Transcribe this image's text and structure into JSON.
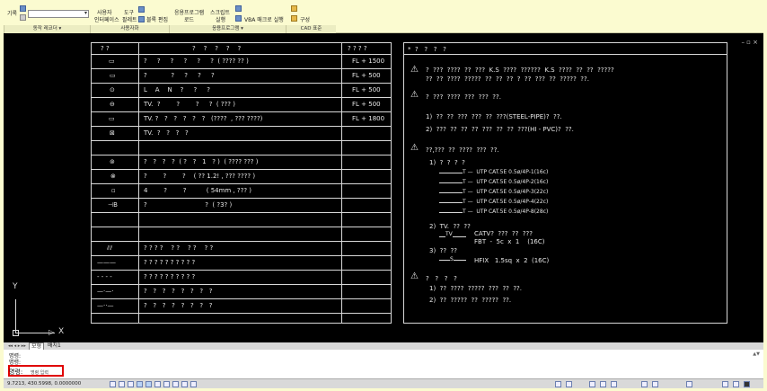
{
  "ribbon": {
    "items": [
      {
        "label": "기록"
      },
      {
        "label": "사용자"
      },
      {
        "label": "인터페이스"
      },
      {
        "label": "도구"
      },
      {
        "label": "팔레트"
      },
      {
        "label": "블록 편집"
      },
      {
        "label": "응용프로그램"
      },
      {
        "label": "로드"
      },
      {
        "label": "스크립트"
      },
      {
        "label": "실행"
      },
      {
        "label": "VBA 매크로 실행"
      },
      {
        "label": "구성"
      }
    ],
    "panels": [
      {
        "label": "동작 레코더 ▾"
      },
      {
        "label": "사용자화"
      },
      {
        "label": "응용프로그램 ▾"
      },
      {
        "label": "CAD 표준"
      }
    ]
  },
  "legend_table": {
    "header": [
      "? ?",
      "?    ?    ?    ?    ?",
      "? ? ? ?"
    ],
    "rows": [
      {
        "symbol": "▭",
        "desc": "?     ?     ?     ?     ?     ?  ( ???? ?? )",
        "height": "FL + 1500"
      },
      {
        "symbol": "▭",
        "desc": "?            ?     ?     ?     ?",
        "height": "FL + 500"
      },
      {
        "symbol": "⊙",
        "desc": "L    A    N    ?     ?     ?",
        "height": "FL + 500"
      },
      {
        "symbol": "⊖",
        "desc": "TV.  ?        ?        ?     ?  ( ??? )",
        "height": "FL + 500"
      },
      {
        "symbol": "▭",
        "desc": "TV. ?   ?   ?   ?   ?   ?   (????  , ??? ????)",
        "height": "FL + 1800"
      },
      {
        "symbol": "⊠",
        "desc": "TV.  ?   ?   ?   ?",
        "height": ""
      },
      {
        "symbol": "",
        "desc": "",
        "height": ""
      },
      {
        "symbol": "⊚",
        "desc": "?   ?   ?   ?  ( ?   ?   1   ? )  ( ???? ??? )",
        "height": ""
      },
      {
        "symbol": "⊗",
        "desc": "?        ?        ?    ( ?? 1.2! , ??? ???? )",
        "height": ""
      },
      {
        "symbol": "▫",
        "desc": "4        ?        ?          ( 54mm , ??? )",
        "height": ""
      },
      {
        "symbol": "⊣B",
        "desc": "?                             ?  ( ?3? )",
        "height": ""
      },
      {
        "symbol": "",
        "desc": "",
        "height": ""
      },
      {
        "symbol": "",
        "desc": "",
        "height": ""
      },
      {
        "symbol": "⫽⫽",
        "desc": "? ? ? ?    ? ?    ? ?    ? ?",
        "height": ""
      },
      {
        "symbol": "———",
        "desc": "? ? ? ? ? ? ? ? ? ?",
        "height": ""
      },
      {
        "symbol": "- - - -",
        "desc": "? ? ? ? ? ? ? ? ? ?",
        "height": ""
      },
      {
        "symbol": "—·—·",
        "desc": "?   ?   ?   ?   ?   ?   ?   ?",
        "height": ""
      },
      {
        "symbol": "—··—",
        "desc": "?   ?   ?   ?   ?   ?   ?   ?",
        "height": ""
      }
    ]
  },
  "notes": {
    "title": "*  ?   ?   ?   ?",
    "note1_line1": "?  ???  ????  ??  ???  K.S  ????  ??????  K.S  ????  ??  ??  ?????",
    "note1_line2": "??  ??  ????  ?????  ??  ??  ??  ?  ??  ???  ??  ?????  ??.",
    "note2": "?  ???  ????  ???  ???  ??.",
    "note2_a": "1)  ??  ??  ???  ???  ??  ???(STEEL-PIPE)?  ??.",
    "note2_b": "2)  ???  ??  ??  ??  ???  ??  ??  ???(HI - PVC)?  ??.",
    "note3": "??,???  ??  ????  ???  ??.",
    "note3_1": "1)  ?  ?  ?  ?",
    "utp": [
      "T —  UTP CAT.5E 0.5ø/4P-1(16c)",
      "T —  UTP CAT.5E 0.5ø/4P-2(16c)",
      "T —  UTP CAT.5E 0.5ø/4P-3(22c)",
      "T —  UTP CAT.5E 0.5ø/4P-4(22c)",
      "T —  UTP CAT.5E 0.5ø/4P-8(28c)"
    ],
    "note3_2": "2)  TV.  ??  ??",
    "tv_mark": "TV",
    "catv_a": "CATV?  ???  ??  ???",
    "catv_b": "FBT  -  5c  x  1    (16C)",
    "note3_3": "3)  ??  ??",
    "hfix_mark": "S",
    "hfix": "HFIX   1.5sq  x  2  (16C)",
    "note4": "?   ?   ?   ?",
    "note4_a": "1)  ??  ????  ?????  ???  ??  ??.",
    "note4_b": "2)  ??  ?????  ??  ?????  ??."
  },
  "ucs": {
    "x": "X",
    "y": "Y"
  },
  "tabs": [
    {
      "label": "모형"
    },
    {
      "label": "배치1"
    }
  ],
  "command": {
    "line1": "명령:",
    "line2": "명령:",
    "prompt": "명령:",
    "input": "명령 입력"
  },
  "status": {
    "coords": "9.7213, 430.5998, 0.0000000"
  }
}
